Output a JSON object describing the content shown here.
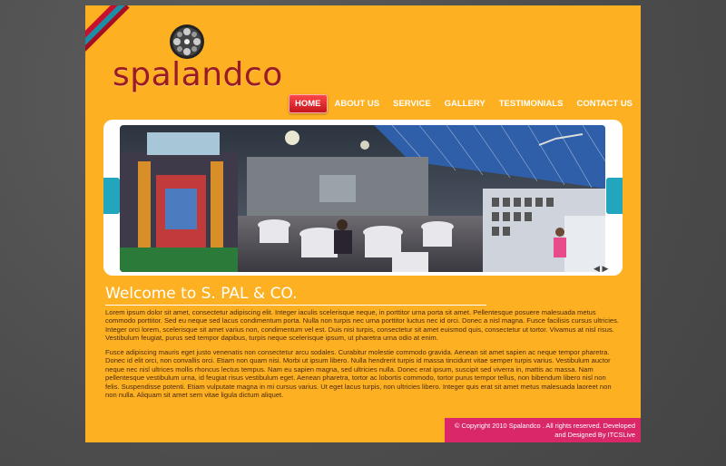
{
  "logo": {
    "text": "spalandco"
  },
  "nav": {
    "items": [
      "HOME",
      "ABOUT US",
      "SERVICE",
      "GALLERY",
      "TESTIMONIALS",
      "CONTACT US"
    ],
    "active": "HOME"
  },
  "banner": {
    "prev_icon": "arrow-left-icon",
    "next_icon": "arrow-right-icon"
  },
  "welcome": {
    "title": "Welcome to S. PAL & CO.",
    "paragraph1": "Lorem ipsum dolor sit amet, consectetur adipiscing elit. Integer iaculis scelerisque neque, in porttitor urna porta sit amet. Pellentesque posuere malesuada metus commodo porttitor. Sed eu neque sed lacus condimentum porta. Nulla non turpis nec urna porttitor luctus nec id orci. Donec a nisl magna. Fusce facilisis cursus ultricies. Integer orci lorem, scelerisque sit amet varius non, condimentum vel est. Duis nisi turpis, consectetur sit amet euismod quis, consectetur ut tortor. Vivamus at nisl risus. Vestibulum feugiat, purus sed tempor dapibus, turpis neque scelerisque ipsum, ut pharetra urna odio at enim.",
    "paragraph2": "Fusce adipiscing mauris eget justo venenatis non consectetur arcu sodales. Curabitur molestie commodo gravida. Aenean sit amet sapien ac neque tempor pharetra. Donec id elit orci, non convallis orci. Etiam non quam nisi. Morbi ut ipsum libero. Nulla hendrerit turpis id massa tincidunt vitae semper turpis varius. Vestibulum auctor neque nec nisl ultrices mollis rhoncus lectus tempus. Nam eu sapien magna, sed ultricies nulla. Donec erat ipsum, suscipit sed viverra in, mattis ac massa. Nam pellentesque vestibulum urna, id feugiat risus vestibulum eget. Aenean pharetra, tortor ac lobortis commodo, tortor purus tempor tellus, non bibendum libero nisl non felis. Suspendisse potenti. Etiam vulputate magna in mi cursus varius. Ut eget lacus turpis, non ultricies libero. Integer quis erat sit amet metus malesuada laoreet non non nulla. Aliquam sit amet sem vitae ligula dictum aliquet."
  },
  "footer": {
    "line1": "© Copyright 2010 Spalandco . All rights reserved. Developed",
    "line2": "and Designed By ITCSLive"
  },
  "colors": {
    "page_bg": "#fdb021",
    "logo_text": "#9a1b27",
    "nav_active": "#d61a22",
    "accent_teal": "#23a5bd",
    "footer_bg": "#d9276a"
  }
}
